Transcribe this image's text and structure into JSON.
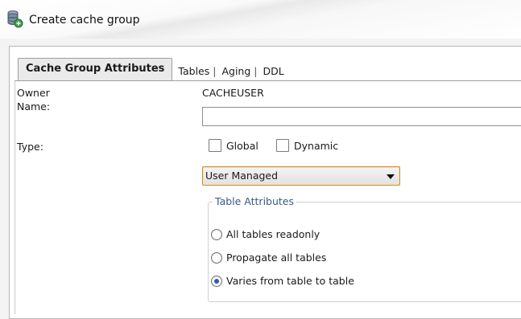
{
  "window": {
    "title": "Create cache group"
  },
  "tabs": [
    {
      "label": "Cache Group Attributes",
      "active": true
    },
    {
      "label": "Tables",
      "active": false
    },
    {
      "label": "Aging",
      "active": false
    },
    {
      "label": "DDL",
      "active": false
    }
  ],
  "tab_separator": "|",
  "form": {
    "owner_label": "Owner",
    "owner_value": "CACHEUSER",
    "name_label": "Name:",
    "name_value": "",
    "type_label": "Type:",
    "global_label": "Global",
    "global_checked": false,
    "dynamic_label": "Dynamic",
    "dynamic_checked": false,
    "type_select_value": "User Managed"
  },
  "table_attributes": {
    "legend": "Table Attributes",
    "options": [
      {
        "label": "All tables readonly",
        "selected": false
      },
      {
        "label": "Propagate all tables",
        "selected": false
      },
      {
        "label": "Varies from table to table",
        "selected": true
      }
    ]
  },
  "colors": {
    "accent_radio": "#2a5db0",
    "legend_text": "#3b5a87",
    "select_border": "#c98a2e"
  },
  "icons": {
    "title": "database-cache-icon"
  }
}
